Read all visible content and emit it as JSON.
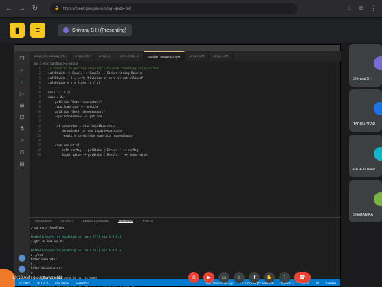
{
  "browser": {
    "url": "https://meet.google.com/sgt-awzx-bkt"
  },
  "meet": {
    "presenter_label": "Shivaraj S H (Presenting)"
  },
  "vscode": {
    "tabs": [
      {
        "label": "arrays_list_sunday.js M",
        "active": false
      },
      {
        "label": "arrays.js M",
        "active": false
      },
      {
        "label": "arrays.js",
        "active": false
      },
      {
        "label": "prime_list.js M",
        "active": false
      },
      {
        "label": "number_sequence.js M",
        "active": true
      },
      {
        "label": "arrays.js M",
        "active": false
      },
      {
        "label": "arrays.js M",
        "active": false
      }
    ],
    "breadcrumb": "dsa > error_handling > js error.js",
    "code": [
      {
        "n": "1",
        "text": "  // function to perform division with error handling using Either"
      },
      {
        "n": "2",
        "text": "  safeDivide :: Double -> Double -> Either String Double"
      },
      {
        "n": "3",
        "text": "  safeDivide _ 0 = Left \"Division by zero is not allowed\""
      },
      {
        "n": "4",
        "text": "  safeDivide x y = Right (x / y)"
      },
      {
        "n": "5",
        "text": ""
      },
      {
        "n": "6",
        "text": "  main :: IO ()"
      },
      {
        "n": "7",
        "text": "  main = do"
      },
      {
        "n": "8",
        "text": "      putStrLn \"Enter numerator:\""
      },
      {
        "n": "9",
        "text": "      inputNumerator <- getLine"
      },
      {
        "n": "10",
        "text": "      putStrLn \"Enter denominator:\""
      },
      {
        "n": "11",
        "text": "      inputDenominator <- getLine"
      },
      {
        "n": "12",
        "text": ""
      },
      {
        "n": "13",
        "text": "      let numerator = read inputNumerator"
      },
      {
        "n": "14",
        "text": "          denominator = read inputDenominator"
      },
      {
        "n": "15",
        "text": "          result = safeDivide numerator denominator"
      },
      {
        "n": "16",
        "text": ""
      },
      {
        "n": "17",
        "text": "      case result of"
      },
      {
        "n": "18",
        "text": "          Left errMsg -> putStrLn (\"Error: \" ++ errMsg)"
      },
      {
        "n": "19",
        "text": "          Right value -> putStrLn (\"Result: \" ++ show value)"
      }
    ],
    "panel_tabs": [
      {
        "label": "PROBLEMS",
        "active": false
      },
      {
        "label": "OUTPUT",
        "active": false
      },
      {
        "label": "DEBUG CONSOLE",
        "active": false
      },
      {
        "label": "TERMINAL",
        "active": true
      },
      {
        "label": "PORTS",
        "active": false
      }
    ],
    "terminal": [
      {
        "text": "> cd error_handling",
        "kind": "out"
      },
      {
        "text": "",
        "kind": "out"
      },
      {
        "text": "Haskell/dsa/error_handling on  main [!?] via λ 9.6.6",
        "kind": "path"
      },
      {
        "text": "> ghc -o end end.hs",
        "kind": "out"
      },
      {
        "text": "",
        "kind": "out"
      },
      {
        "text": "Haskell/dsa/error_handling on  main [!?] via λ 9.6.6",
        "kind": "path"
      },
      {
        "text": "> ./end",
        "kind": "out"
      },
      {
        "text": "Enter numerator:",
        "kind": "out"
      },
      {
        "text": "5",
        "kind": "out"
      },
      {
        "text": "Enter denominator:",
        "kind": "out"
      },
      {
        "text": "0",
        "kind": "out"
      },
      {
        "text": "Error: Division by zero is not allowed",
        "kind": "out"
      },
      {
        "text": "",
        "kind": "out"
      },
      {
        "text": "Haskell/dsa/error_handling on  main [!?] via λ 9.6.6 took 9s",
        "kind": "path"
      },
      {
        "text": "> ",
        "kind": "out"
      }
    ],
    "status_left": [
      "⎇ main*",
      "⊗ 0 ⚠ 0",
      "Live Share",
      "HASKELL"
    ],
    "status_right": [
      "You, 19 seconds ago",
      "Ln 3, Col 55 (27 selected)",
      "Spaces: 4",
      "UTF-8",
      "LF",
      "Haskell"
    ]
  },
  "participants": [
    {
      "name": "Shivaraj S H",
      "color": "#7a6bd6"
    },
    {
      "name": "TARUN PRAD",
      "color": "#1a73e8"
    },
    {
      "name": "RAJA KUMAR",
      "color": "#12b5cb"
    },
    {
      "name": "SHABAN RA",
      "color": "#7cb342"
    }
  ],
  "footer": {
    "time": "10:13 AM",
    "meeting_code": "sgt-awzx-bkt"
  }
}
